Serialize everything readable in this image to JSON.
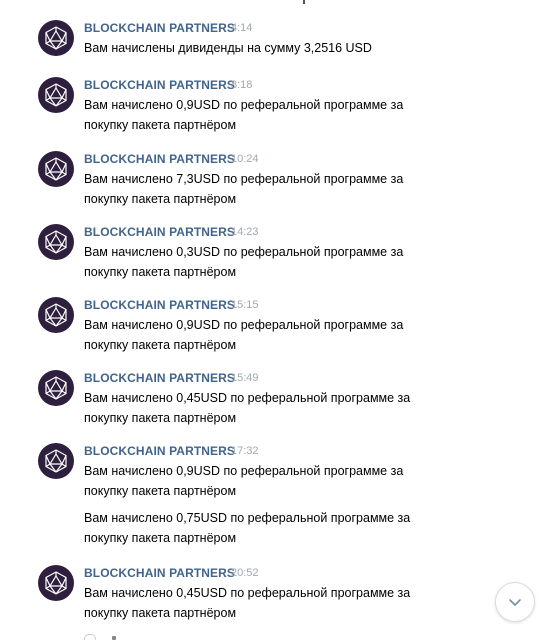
{
  "messages": [
    {
      "author": "BLOCKCHAIN PARTNERS",
      "time": "4:14",
      "text": "Вам начислены дивиденды на сумму 3,2516 USD"
    },
    {
      "author": "BLOCKCHAIN PARTNERS",
      "time": "8:18",
      "text": "Вам начислено 0,9USD по реферальной программе за покупку пакета партнёром"
    },
    {
      "author": "BLOCKCHAIN PARTNERS",
      "time": "10:24",
      "text": "Вам начислено 7,3USD по реферальной программе за покупку пакета партнёром"
    },
    {
      "author": "BLOCKCHAIN PARTNERS",
      "time": "14:23",
      "text": "Вам начислено 0,3USD по реферальной программе за покупку пакета партнёром"
    },
    {
      "author": "BLOCKCHAIN PARTNERS",
      "time": "15:15",
      "text": "Вам начислено 0,9USD по реферальной программе за покупку пакета партнёром"
    },
    {
      "author": "BLOCKCHAIN PARTNERS",
      "time": "15:49",
      "text": "Вам начислено 0,45USD по реферальной программе за покупку пакета партнёром"
    },
    {
      "author": "BLOCKCHAIN PARTNERS",
      "time": "17:32",
      "text": "Вам начислено 0,9USD по реферальной программе за покупку пакета партнёром",
      "followup": "Вам начислено 0,75USD по реферальной программе за покупку пакета партнёром"
    },
    {
      "author": "BLOCKCHAIN PARTNERS",
      "time": "20:52",
      "text": "Вам начислено 0,45USD по реферальной программе за покупку пакета партнёром"
    }
  ],
  "icons": {
    "avatar": "blockchain-logo-icon",
    "scroll_down": "chevron-down-icon"
  },
  "colors": {
    "author": "#42648b",
    "time": "#a0a8b2",
    "avatar_bg": "#2d1f3d"
  }
}
